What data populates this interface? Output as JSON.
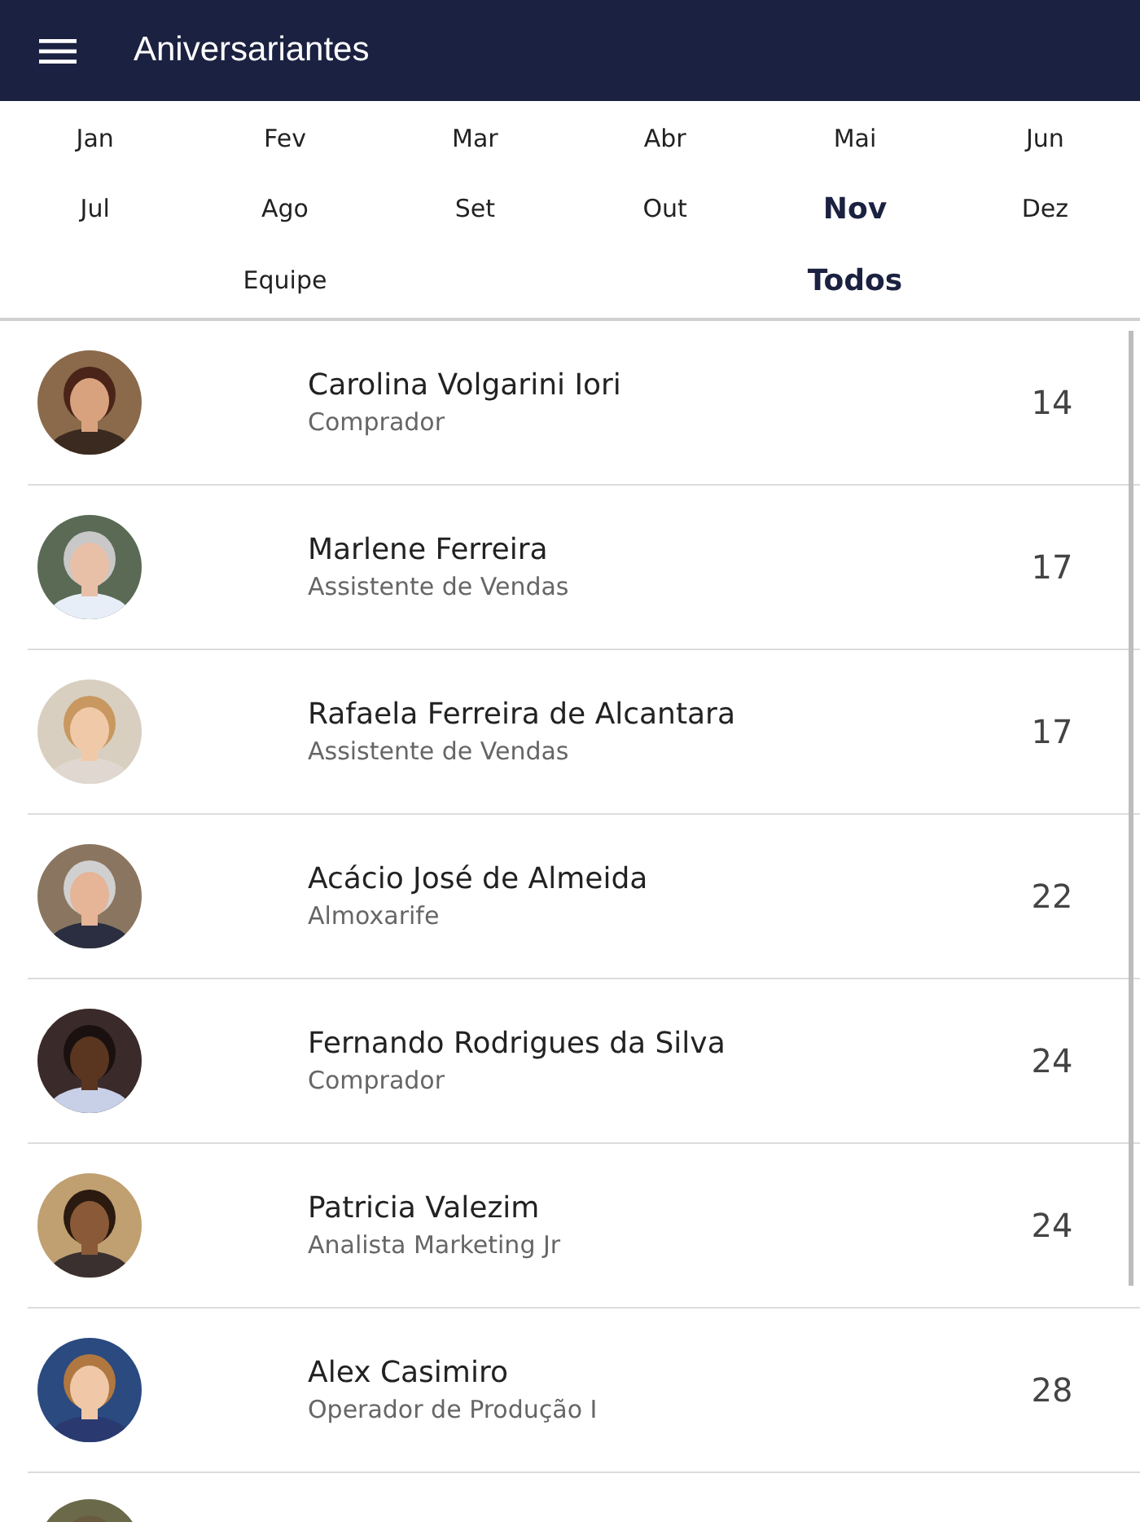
{
  "app_bar": {
    "title": "Aniversariantes"
  },
  "months": [
    {
      "label": "Jan",
      "selected": false
    },
    {
      "label": "Fev",
      "selected": false
    },
    {
      "label": "Mar",
      "selected": false
    },
    {
      "label": "Abr",
      "selected": false
    },
    {
      "label": "Mai",
      "selected": false
    },
    {
      "label": "Jun",
      "selected": false
    },
    {
      "label": "Jul",
      "selected": false
    },
    {
      "label": "Ago",
      "selected": false
    },
    {
      "label": "Set",
      "selected": false
    },
    {
      "label": "Out",
      "selected": false
    },
    {
      "label": "Nov",
      "selected": true
    },
    {
      "label": "Dez",
      "selected": false
    }
  ],
  "filters": [
    {
      "label": "Equipe",
      "selected": false
    },
    {
      "label": "Todos",
      "selected": true
    }
  ],
  "people": [
    {
      "name": "Carolina Volgarini Iori",
      "role": "Comprador",
      "day": "14"
    },
    {
      "name": "Marlene Ferreira",
      "role": "Assistente de Vendas",
      "day": "17"
    },
    {
      "name": "Rafaela Ferreira de Alcantara",
      "role": "Assistente de Vendas",
      "day": "17"
    },
    {
      "name": "Acácio José de Almeida",
      "role": "Almoxarife",
      "day": "22"
    },
    {
      "name": "Fernando Rodrigues da Silva",
      "role": "Comprador",
      "day": "24"
    },
    {
      "name": "Patricia Valezim",
      "role": "Analista Marketing Jr",
      "day": "24"
    },
    {
      "name": "Alex Casimiro",
      "role": "Operador de Produção I",
      "day": "28"
    }
  ]
}
